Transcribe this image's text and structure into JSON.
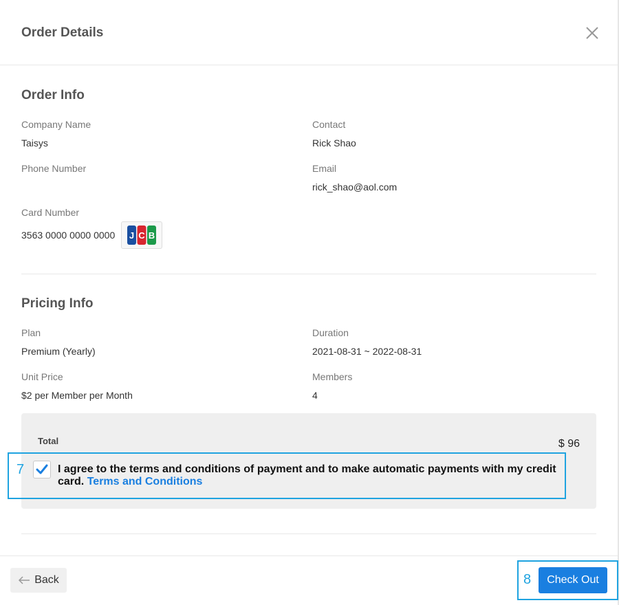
{
  "header": {
    "title": "Order Details"
  },
  "order_info": {
    "title": "Order Info",
    "company_label": "Company Name",
    "company_value": "Taisys",
    "contact_label": "Contact",
    "contact_value": "Rick Shao",
    "phone_label": "Phone Number",
    "phone_value": "",
    "email_label": "Email",
    "email_value": "rick_shao@aol.com",
    "card_label": "Card Number",
    "card_value": "3563 0000 0000 0000",
    "card_brand": "JCB"
  },
  "pricing_info": {
    "title": "Pricing Info",
    "plan_label": "Plan",
    "plan_value": "Premium (Yearly)",
    "duration_label": "Duration",
    "duration_value": "2021-08-31 ~ 2022-08-31",
    "unit_price_label": "Unit Price",
    "unit_price_value": "$2 per Member per Month",
    "members_label": "Members",
    "members_value": "4"
  },
  "total": {
    "label": "Total",
    "value": "$ 96"
  },
  "agreement": {
    "marker": "7",
    "checked": true,
    "text": "I agree to the terms and conditions of payment and to make automatic payments with my credit card.",
    "link": "Terms and Conditions"
  },
  "footer": {
    "back_label": "Back",
    "checkout_marker": "8",
    "checkout_label": "Check Out"
  },
  "colors": {
    "accent": "#1a7fe0",
    "annotation": "#1ea3e0",
    "jcb_blue": "#1a4fa0",
    "jcb_red": "#d8262f",
    "jcb_green": "#1c9a4a"
  },
  "icons": [
    "close-icon",
    "check-icon",
    "arrow-left-icon",
    "jcb-card-icon"
  ]
}
